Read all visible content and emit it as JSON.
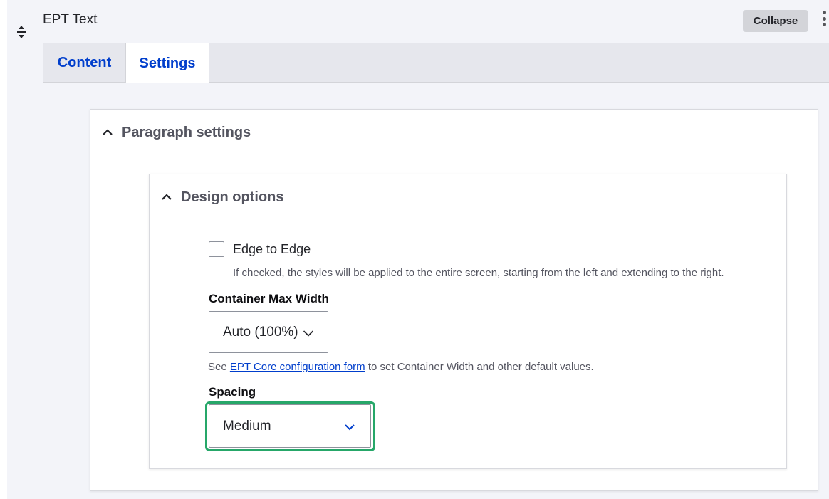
{
  "row": {
    "title": "EPT Text",
    "collapse_label": "Collapse",
    "drag_icon": "drag-handle-icon",
    "menu_icon": "kebab-menu-icon"
  },
  "tabs": [
    {
      "label": "Content",
      "active": false
    },
    {
      "label": "Settings",
      "active": true
    }
  ],
  "paragraph_settings": {
    "summary": "Paragraph settings",
    "expanded": true,
    "design_options": {
      "summary": "Design options",
      "expanded": true,
      "edge_to_edge": {
        "label": "Edge to Edge",
        "checked": false,
        "description": "If checked, the styles will be applied to the entire screen, starting from the left and extending to the right."
      },
      "container_max_width": {
        "label": "Container Max Width",
        "value": "Auto (100%)"
      },
      "help": {
        "prefix": "See ",
        "link_text": "EPT Core configuration form",
        "suffix": " to set Container Width and other default values."
      },
      "spacing": {
        "label": "Spacing",
        "value": "Medium"
      }
    }
  },
  "colors": {
    "link": "#003ecc",
    "focus": "#26a769",
    "tab_bar": "#e6e7ed",
    "row_bg": "#f3f4f9"
  }
}
